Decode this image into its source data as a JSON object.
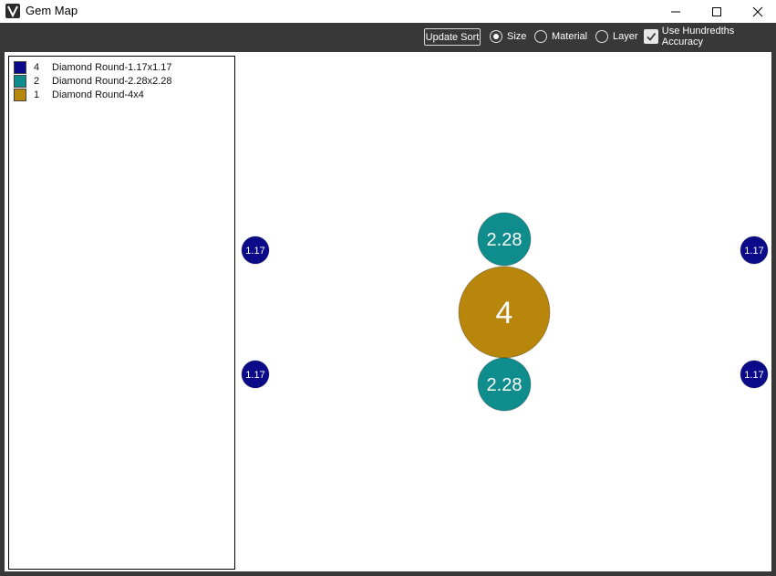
{
  "window": {
    "title": "Gem Map",
    "app_icon": "vectorworks-v-icon",
    "controls": [
      "minimize-icon",
      "maximize-icon",
      "close-icon"
    ]
  },
  "toolbar": {
    "update_sort_label": "Update Sort",
    "sort_options": [
      {
        "label": "Size",
        "selected": true
      },
      {
        "label": "Material",
        "selected": false
      },
      {
        "label": "Layer",
        "selected": false
      }
    ],
    "hundredths_label": "Use Hundredths Accuracy",
    "hundredths_checked": true
  },
  "legend": [
    {
      "count": "4",
      "name": "Diamond Round-1.17x1.17",
      "color": "#0b0b8a"
    },
    {
      "count": "2",
      "name": "Diamond Round-2.28x2.28",
      "color": "#0f8c8c"
    },
    {
      "count": "1",
      "name": "Diamond Round-4x4",
      "color": "#b8860b"
    }
  ],
  "gems": [
    {
      "label": "1.17",
      "color": "#0b0b8a"
    },
    {
      "label": "1.17",
      "color": "#0b0b8a"
    },
    {
      "label": "2.28",
      "color": "#0f8c8c"
    },
    {
      "label": "4",
      "color": "#b8860b"
    },
    {
      "label": "2.28",
      "color": "#0f8c8c"
    },
    {
      "label": "1.17",
      "color": "#0b0b8a"
    },
    {
      "label": "1.17",
      "color": "#0b0b8a"
    }
  ]
}
